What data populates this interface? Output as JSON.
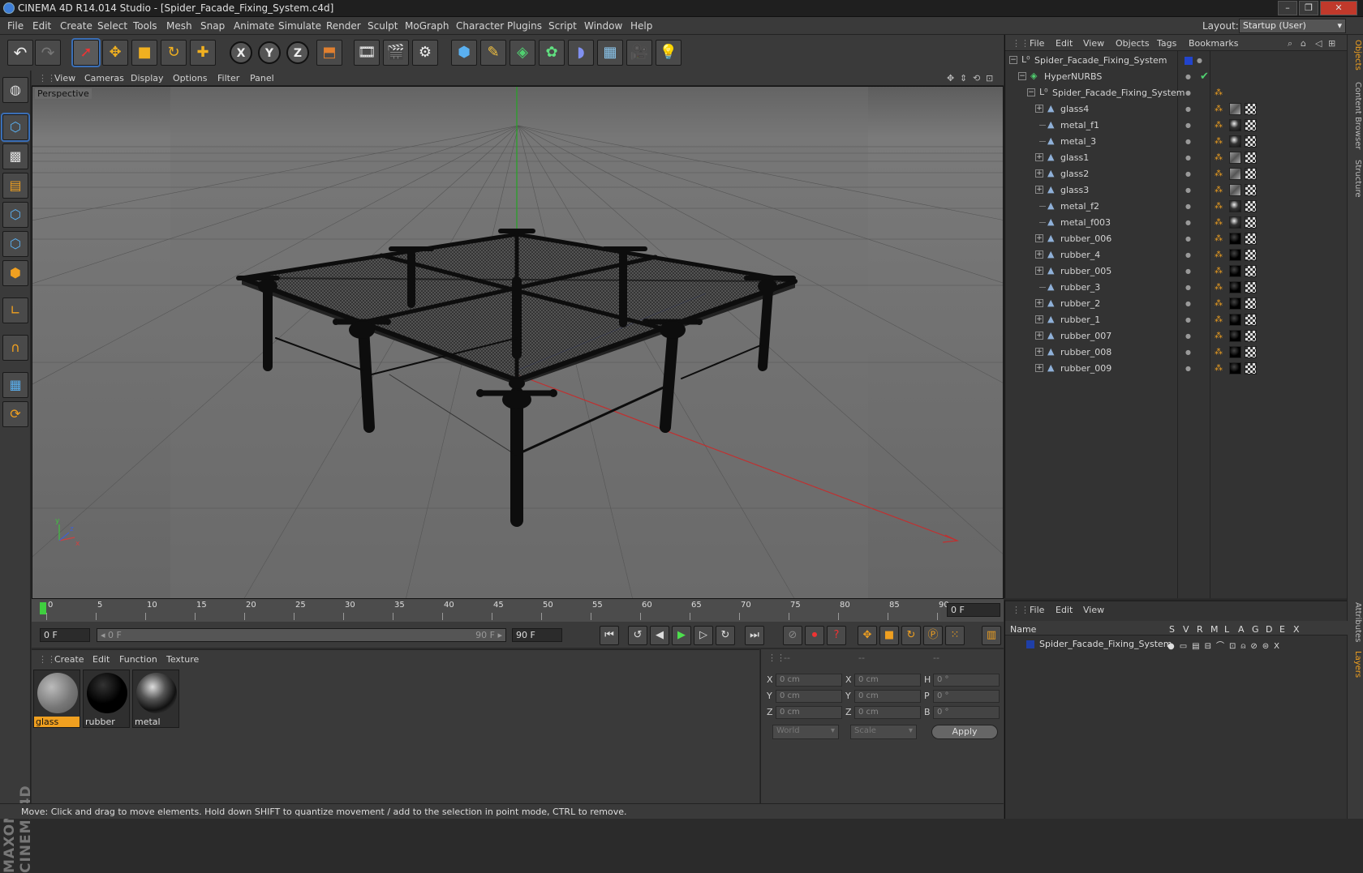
{
  "window": {
    "title": "CINEMA 4D R14.014 Studio - [Spider_Facade_Fixing_System.c4d]",
    "controls": [
      "–",
      "❐",
      "✕"
    ]
  },
  "menu": [
    "File",
    "Edit",
    "Create",
    "Select",
    "Tools",
    "Mesh",
    "Snap",
    "Animate",
    "Simulate",
    "Render",
    "Sculpt",
    "MoGraph",
    "Character",
    "Plugins",
    "Script",
    "Window",
    "Help"
  ],
  "layout": {
    "label": "Layout:",
    "value": "Startup (User)"
  },
  "viewport": {
    "menu": [
      "View",
      "Cameras",
      "Display",
      "Options",
      "Filter",
      "Panel"
    ],
    "label": "Perspective",
    "axis_labels": {
      "x": "x",
      "y": "y",
      "z": "z"
    }
  },
  "timeline": {
    "ticks": [
      "0",
      "5",
      "10",
      "15",
      "20",
      "25",
      "30",
      "35",
      "40",
      "45",
      "50",
      "55",
      "60",
      "65",
      "70",
      "75",
      "80",
      "85",
      "90"
    ],
    "current_frame_field": "0 F",
    "start_field": "0 F",
    "range_start": "◂ 0 F",
    "range_end": "90 F ▸",
    "end_field": "90 F"
  },
  "materials": {
    "menu": [
      "Create",
      "Edit",
      "Function",
      "Texture"
    ],
    "items": [
      {
        "name": "glass",
        "selected": true
      },
      {
        "name": "rubber",
        "selected": false
      },
      {
        "name": "metal",
        "selected": false
      }
    ]
  },
  "coords": {
    "headers": [
      "--",
      "--",
      "--"
    ],
    "rows": [
      {
        "a": "X",
        "av": "0 cm",
        "b": "X",
        "bv": "0 cm",
        "c": "H",
        "cv": "0 °"
      },
      {
        "a": "Y",
        "av": "0 cm",
        "b": "Y",
        "bv": "0 cm",
        "c": "P",
        "cv": "0 °"
      },
      {
        "a": "Z",
        "av": "0 cm",
        "b": "Z",
        "bv": "0 cm",
        "c": "B",
        "cv": "0 °"
      }
    ],
    "world": "World",
    "scale": "Scale",
    "apply": "Apply"
  },
  "status": "Move: Click and drag to move elements. Hold down SHIFT to quantize movement / add to the selection in point mode, CTRL to remove.",
  "objects": {
    "menu": [
      "File",
      "Edit",
      "View",
      "Objects",
      "Tags",
      "Bookmarks"
    ],
    "root": "Spider_Facade_Fixing_System",
    "hypernurbs": "HyperNURBS",
    "group": "Spider_Facade_Fixing_System",
    "children": [
      {
        "name": "glass4",
        "mat": "glass",
        "expand": true
      },
      {
        "name": "metal_f1",
        "mat": "metal",
        "expand": false
      },
      {
        "name": "metal_3",
        "mat": "metal",
        "expand": false
      },
      {
        "name": "glass1",
        "mat": "glass",
        "expand": true
      },
      {
        "name": "glass2",
        "mat": "glass",
        "expand": true
      },
      {
        "name": "glass3",
        "mat": "glass",
        "expand": true
      },
      {
        "name": "metal_f2",
        "mat": "metal",
        "expand": false
      },
      {
        "name": "metal_f003",
        "mat": "metal",
        "expand": false
      },
      {
        "name": "rubber_006",
        "mat": "rubber",
        "expand": true
      },
      {
        "name": "rubber_4",
        "mat": "rubber",
        "expand": true
      },
      {
        "name": "rubber_005",
        "mat": "rubber",
        "expand": true
      },
      {
        "name": "rubber_3",
        "mat": "rubber",
        "expand": false
      },
      {
        "name": "rubber_2",
        "mat": "rubber",
        "expand": true
      },
      {
        "name": "rubber_1",
        "mat": "rubber",
        "expand": true
      },
      {
        "name": "rubber_007",
        "mat": "rubber",
        "expand": true
      },
      {
        "name": "rubber_008",
        "mat": "rubber",
        "expand": true
      },
      {
        "name": "rubber_009",
        "mat": "rubber",
        "expand": true
      }
    ]
  },
  "attributes": {
    "menu": [
      "File",
      "Edit",
      "View"
    ],
    "name_header": "Name",
    "flag_headers": [
      "S",
      "V",
      "R",
      "M",
      "L",
      "A",
      "G",
      "D",
      "E",
      "X"
    ],
    "layer_name": "Spider_Facade_Fixing_System"
  },
  "side_tabs": {
    "top": [
      "Objects",
      "Content Browser",
      "Structure"
    ],
    "bottom": [
      "Attributes",
      "Layers"
    ]
  },
  "colors": {
    "accent": "#f0a020",
    "selection": "#3b6fb6",
    "layer": "#1f3fa8"
  },
  "icons": {
    "toolbar": [
      "undo-icon",
      "redo-icon",
      "live-selection-icon",
      "move-icon",
      "scale-icon",
      "rotate-icon",
      "recent-tool-icon",
      "x-axis-icon",
      "y-axis-icon",
      "z-axis-icon",
      "coordinate-system-icon",
      "render-view-icon",
      "render-picture-viewer-icon",
      "edit-render-settings-icon",
      "cube-icon",
      "spline-pen-icon",
      "subdivision-icon",
      "array-icon",
      "deformer-icon",
      "floor-icon",
      "camera-icon",
      "light-icon"
    ],
    "left": [
      "make-editable-icon",
      "model-mode-icon",
      "texture-mode-icon",
      "workplane-icon",
      "points-mode-icon",
      "edges-mode-icon",
      "polygons-mode-icon",
      "axis-mode-icon",
      "magnet-icon",
      "snap-enable-icon",
      "snap-settings-icon"
    ]
  }
}
